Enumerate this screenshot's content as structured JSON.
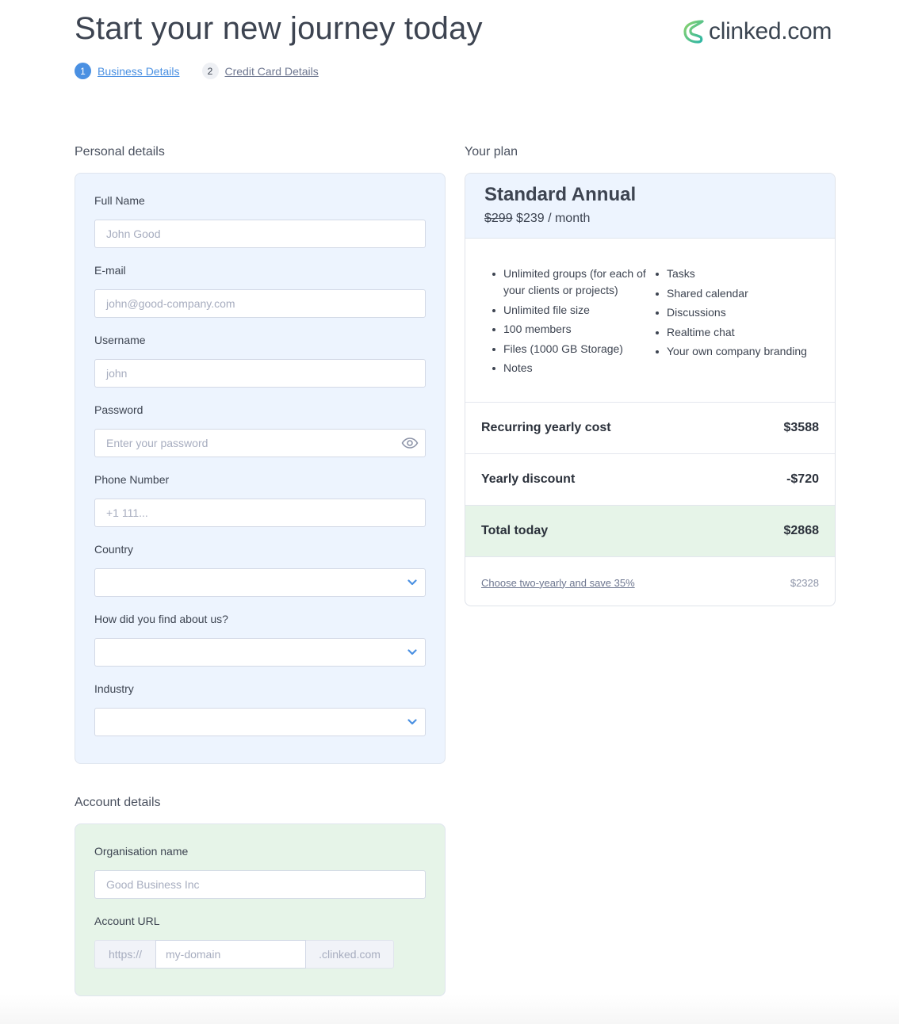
{
  "header": {
    "title": "Start your new journey today",
    "logo_text": "clinked.com",
    "steps": [
      {
        "number": "1",
        "label": "Business Details",
        "active": true
      },
      {
        "number": "2",
        "label": "Credit Card Details",
        "active": false
      }
    ]
  },
  "personal": {
    "section_title": "Personal details",
    "fields": {
      "full_name": {
        "label": "Full Name",
        "placeholder": "John Good",
        "value": ""
      },
      "email": {
        "label": "E-mail",
        "placeholder": "john@good-company.com",
        "value": ""
      },
      "username": {
        "label": "Username",
        "placeholder": "john",
        "value": ""
      },
      "password": {
        "label": "Password",
        "placeholder": "Enter your  password",
        "value": "",
        "icon": "eye-icon"
      },
      "phone": {
        "label": "Phone Number",
        "placeholder": "+1 111...",
        "value": ""
      },
      "country": {
        "label": "Country",
        "selected": "",
        "icon": "chevron-down-icon"
      },
      "referral": {
        "label": "How did you find about us?",
        "selected": "",
        "icon": "chevron-down-icon"
      },
      "industry": {
        "label": "Industry",
        "selected": "",
        "icon": "chevron-down-icon"
      }
    }
  },
  "account": {
    "section_title": "Account details",
    "fields": {
      "organisation": {
        "label": "Organisation name",
        "placeholder": "Good Business Inc",
        "value": ""
      },
      "url": {
        "label": "Account URL",
        "prefix": "https://",
        "placeholder": "my-domain",
        "suffix": ".clinked.com",
        "value": ""
      }
    }
  },
  "plan": {
    "section_title": "Your plan",
    "name": "Standard Annual",
    "old_price": "$299",
    "new_price": "$239 / month",
    "features_left": [
      "Unlimited groups (for each of your clients or projects)",
      "Unlimited file size",
      "100 members",
      "Files (1000 GB Storage)",
      "Notes"
    ],
    "features_right": [
      "Tasks",
      "Shared calendar",
      "Discussions",
      "Realtime chat",
      "Your own company branding"
    ],
    "costs": {
      "recurring": {
        "label": "Recurring yearly cost",
        "value": "$3588"
      },
      "discount": {
        "label": "Yearly discount",
        "value": "-$720"
      },
      "total": {
        "label": "Total today",
        "value": "$2868"
      }
    },
    "upsell": {
      "label": "Choose two-yearly and save 35%",
      "value": "$2328"
    }
  },
  "colors": {
    "accent": "#4a90e2",
    "text": "#3d4451",
    "personal_panel": "#edf4fe",
    "account_panel": "#e6f4e8",
    "logo_gradient_start": "#8cd36b",
    "logo_gradient_end": "#2cb5a6"
  }
}
